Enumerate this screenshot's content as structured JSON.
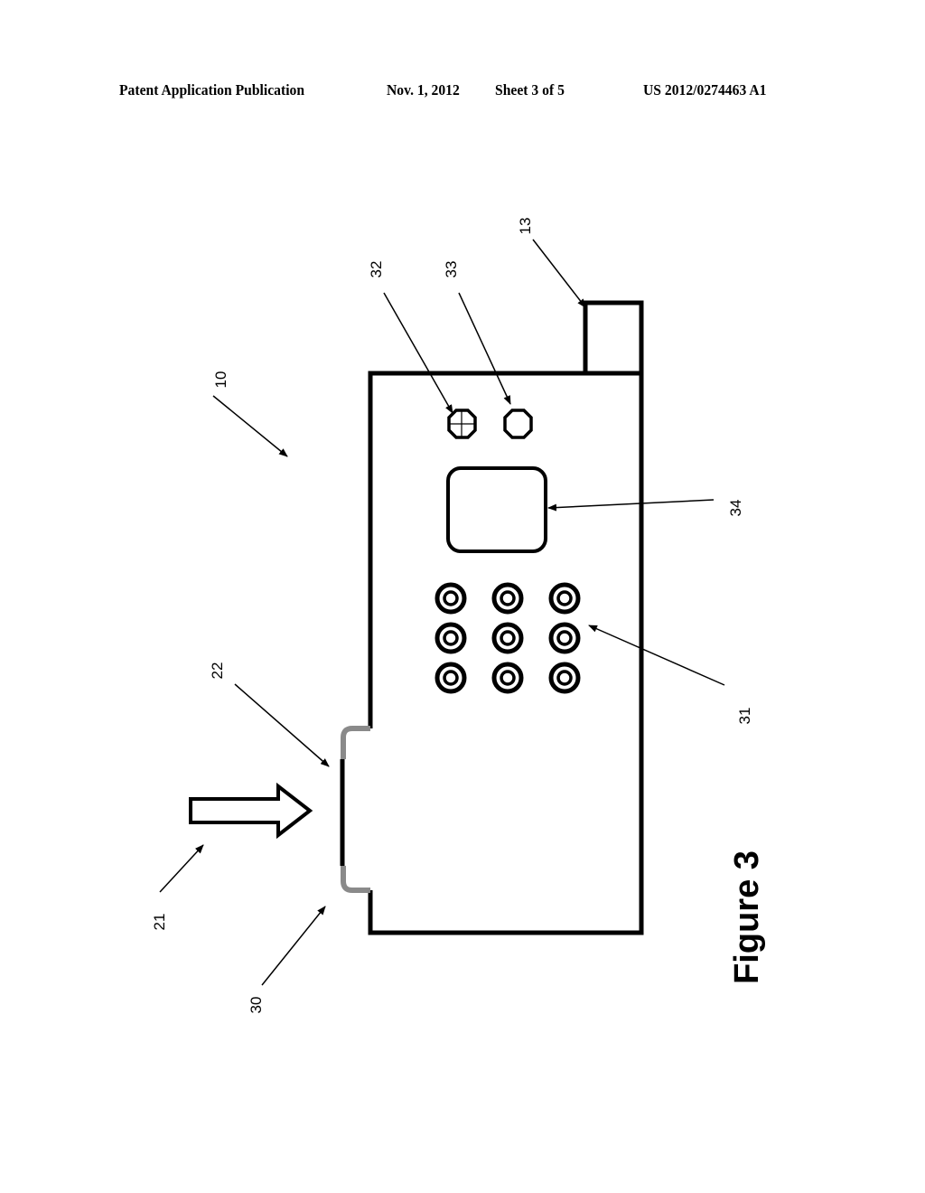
{
  "header": {
    "publication": "Patent Application Publication",
    "date": "Nov. 1, 2012",
    "sheet": "Sheet 3 of 5",
    "number": "US 2012/0274463 A1"
  },
  "figure": {
    "caption": "Figure 3",
    "labels": {
      "device": "10",
      "tab": "13",
      "direction": "21",
      "contact_surface": "22",
      "notch": "30",
      "keypad": "31",
      "button_a": "32",
      "button_b": "33",
      "display": "34"
    },
    "keypad_rows": 3,
    "keypad_cols": 3
  }
}
